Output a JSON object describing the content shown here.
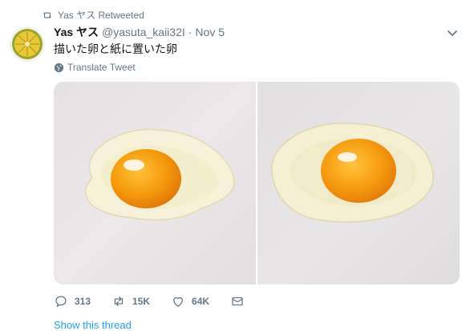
{
  "retweet": {
    "text": "Yas ヤス Retweeted",
    "icon": "retweet-icon"
  },
  "tweet": {
    "name": "Yas ヤス",
    "handle": "@yasuta_kaii32I",
    "separator": "·",
    "date": "Nov 5",
    "text": "描いた卵と紙に置いた卵",
    "translate_label": "Translate Tweet"
  },
  "actions": {
    "replies": "313",
    "retweets": "15K",
    "likes": "64K"
  },
  "show_thread": "Show this thread",
  "colors": {
    "secondary": "#657786",
    "link": "#1da1f2",
    "yolk": "#f29a0e"
  }
}
